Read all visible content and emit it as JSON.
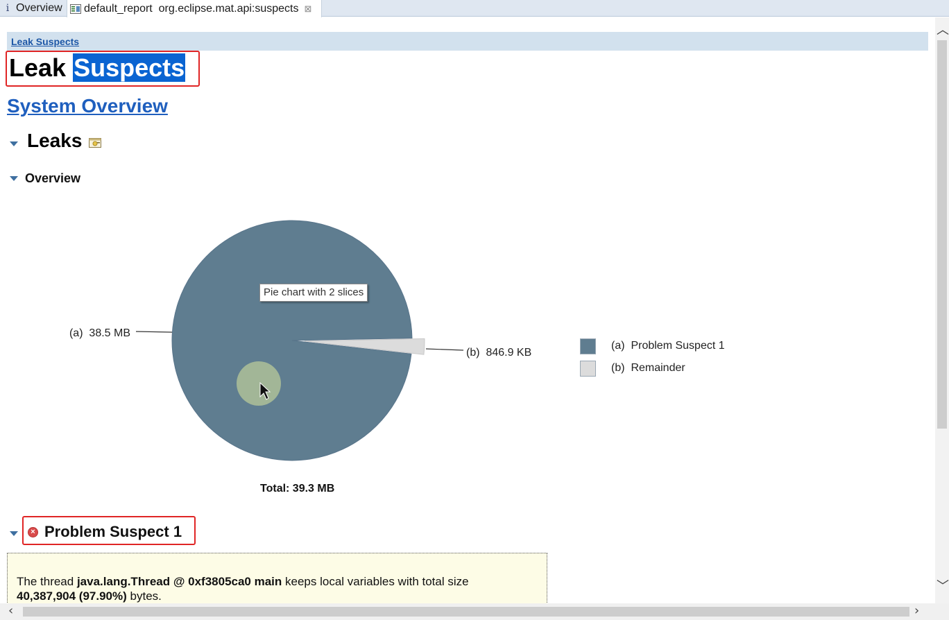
{
  "tabs": [
    {
      "label": "Overview",
      "icon": "info-icon"
    },
    {
      "label": "default_report  org.eclipse.mat.api:suspects",
      "icon": "report-icon",
      "close": "⊠"
    }
  ],
  "breadcrumb": "Leak Suspects",
  "title": {
    "part1": "Leak",
    "part2": "Suspects"
  },
  "system_overview_link": "System Overview",
  "sections": {
    "leaks": "Leaks",
    "overview": "Overview"
  },
  "tooltip": "Pie chart with 2 slices",
  "chart_data": {
    "type": "pie",
    "total_label": "Total: 39.3 MB",
    "slices": [
      {
        "label": "(a)  38.5 MB",
        "legend": "(a)  Problem Suspect 1",
        "value_bytes": 40387904,
        "percent": 97.9,
        "color": "#5f7d90"
      },
      {
        "label": "(b)  846.9 KB",
        "legend": "(b)  Remainder",
        "value_bytes": 867226,
        "percent": 2.1,
        "color": "#dcdcdc"
      }
    ]
  },
  "suspect": {
    "heading": "Problem Suspect 1",
    "text_prefix": "The thread ",
    "thread": "java.lang.Thread @ 0xf3805ca0 main",
    "text_mid": " keeps local variables with total size",
    "size": "40,387,904 (97.90%)",
    "text_suffix": " bytes."
  },
  "colors": {
    "accent": "#1f5fbe",
    "selection": "#0a64d2",
    "highlight_border": "#e02525",
    "panel_bg": "#fdfce6"
  }
}
